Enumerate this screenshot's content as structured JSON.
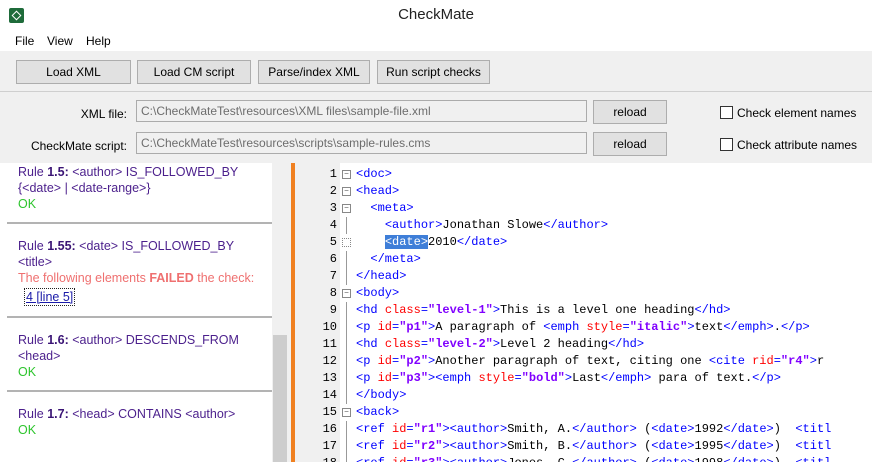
{
  "window": {
    "title": "CheckMate"
  },
  "menu": [
    "File",
    "View",
    "Help"
  ],
  "toolbar": {
    "load_xml": "Load XML",
    "load_cm": "Load CM script",
    "parse": "Parse/index XML",
    "run": "Run script checks"
  },
  "config": {
    "xml_label": "XML file:",
    "xml_value": "C:\\CheckMateTest\\resources\\XML files\\sample-file.xml",
    "script_label": "CheckMate script:",
    "script_value": "C:\\CheckMateTest\\resources\\scripts\\sample-rules.cms",
    "reload": "reload",
    "check_elements": "Check element names",
    "check_attributes": "Check attribute names"
  },
  "rules": [
    {
      "prefix": "Rule ",
      "num": "1.5:",
      "text": " <author> IS_FOLLOWED_BY {<date> | <date-range>}",
      "result": "OK"
    },
    {
      "prefix": "Rule ",
      "num": "1.55:",
      "text": " <date> IS_FOLLOWED_BY <title>",
      "fail_pre": "The following elements ",
      "fail_word": "FAILED",
      "fail_post": " the check:",
      "link": "4 [line 5]"
    },
    {
      "prefix": "Rule ",
      "num": "1.6:",
      "text": " <author> DESCENDS_FROM <head>",
      "result": "OK"
    },
    {
      "prefix": "Rule ",
      "num": "1.7:",
      "text": " <head> CONTAINS <author>",
      "result": "OK"
    }
  ],
  "code_lines": [
    {
      "n": "1",
      "segs": [
        [
          "t",
          "<doc>"
        ]
      ]
    },
    {
      "n": "2",
      "segs": [
        [
          "t",
          "<head>"
        ]
      ]
    },
    {
      "n": "3",
      "segs": [
        [
          "",
          "  "
        ],
        [
          "t",
          "<meta>"
        ]
      ]
    },
    {
      "n": "4",
      "segs": [
        [
          "",
          "    "
        ],
        [
          "t",
          "<author>"
        ],
        [
          "",
          "Jonathan Slowe"
        ],
        [
          "t",
          "</author>"
        ]
      ]
    },
    {
      "n": "5",
      "segs": [
        [
          "",
          "    "
        ],
        [
          "sel",
          "<date>"
        ],
        [
          "",
          "2010"
        ],
        [
          "t",
          "</date>"
        ]
      ]
    },
    {
      "n": "6",
      "segs": [
        [
          "",
          "  "
        ],
        [
          "t",
          "</meta>"
        ]
      ]
    },
    {
      "n": "7",
      "segs": [
        [
          "t",
          "</head>"
        ]
      ]
    },
    {
      "n": "8",
      "segs": [
        [
          "t",
          "<body>"
        ]
      ]
    },
    {
      "n": "9",
      "segs": [
        [
          "t",
          "<hd "
        ],
        [
          "a",
          "class"
        ],
        [
          "t",
          "="
        ],
        [
          "v",
          "\"level-1\""
        ],
        [
          "t",
          ">"
        ],
        [
          "",
          "This is a level one heading"
        ],
        [
          "t",
          "</hd>"
        ]
      ]
    },
    {
      "n": "10",
      "segs": [
        [
          "t",
          "<p "
        ],
        [
          "a",
          "id"
        ],
        [
          "t",
          "="
        ],
        [
          "v",
          "\"p1\""
        ],
        [
          "t",
          ">"
        ],
        [
          "",
          "A paragraph of "
        ],
        [
          "t",
          "<emph "
        ],
        [
          "a",
          "style"
        ],
        [
          "t",
          "="
        ],
        [
          "v",
          "\"italic\""
        ],
        [
          "t",
          ">"
        ],
        [
          "",
          "text"
        ],
        [
          "t",
          "</emph>"
        ],
        [
          "",
          "."
        ],
        [
          "t",
          "</p>"
        ]
      ]
    },
    {
      "n": "11",
      "segs": [
        [
          "t",
          "<hd "
        ],
        [
          "a",
          "class"
        ],
        [
          "t",
          "="
        ],
        [
          "v",
          "\"level-2\""
        ],
        [
          "t",
          ">"
        ],
        [
          "",
          "Level 2 heading"
        ],
        [
          "t",
          "</hd>"
        ]
      ]
    },
    {
      "n": "12",
      "segs": [
        [
          "t",
          "<p "
        ],
        [
          "a",
          "id"
        ],
        [
          "t",
          "="
        ],
        [
          "v",
          "\"p2\""
        ],
        [
          "t",
          ">"
        ],
        [
          "",
          "Another paragraph of text, citing one "
        ],
        [
          "t",
          "<cite "
        ],
        [
          "a",
          "rid"
        ],
        [
          "t",
          "="
        ],
        [
          "v",
          "\"r4\""
        ],
        [
          "t",
          ">"
        ],
        [
          "",
          "r"
        ]
      ]
    },
    {
      "n": "13",
      "segs": [
        [
          "t",
          "<p "
        ],
        [
          "a",
          "id"
        ],
        [
          "t",
          "="
        ],
        [
          "v",
          "\"p3\""
        ],
        [
          "t",
          ">"
        ],
        [
          "t",
          "<emph "
        ],
        [
          "a",
          "style"
        ],
        [
          "t",
          "="
        ],
        [
          "v",
          "\"bold\""
        ],
        [
          "t",
          ">"
        ],
        [
          "",
          "Last"
        ],
        [
          "t",
          "</emph>"
        ],
        [
          "",
          " para of text."
        ],
        [
          "t",
          "</p>"
        ]
      ]
    },
    {
      "n": "14",
      "segs": [
        [
          "t",
          "</body>"
        ]
      ]
    },
    {
      "n": "15",
      "segs": [
        [
          "t",
          "<back>"
        ]
      ]
    },
    {
      "n": "16",
      "segs": [
        [
          "t",
          "<ref "
        ],
        [
          "a",
          "id"
        ],
        [
          "t",
          "="
        ],
        [
          "v",
          "\"r1\""
        ],
        [
          "t",
          ">"
        ],
        [
          "t",
          "<author>"
        ],
        [
          "",
          "Smith, A."
        ],
        [
          "t",
          "</author>"
        ],
        [
          "",
          " ("
        ],
        [
          "t",
          "<date>"
        ],
        [
          "",
          "1992"
        ],
        [
          "t",
          "</date>"
        ],
        [
          "",
          ")  "
        ],
        [
          "t",
          "<titl"
        ]
      ]
    },
    {
      "n": "17",
      "segs": [
        [
          "t",
          "<ref "
        ],
        [
          "a",
          "id"
        ],
        [
          "t",
          "="
        ],
        [
          "v",
          "\"r2\""
        ],
        [
          "t",
          ">"
        ],
        [
          "t",
          "<author>"
        ],
        [
          "",
          "Smith, B."
        ],
        [
          "t",
          "</author>"
        ],
        [
          "",
          " ("
        ],
        [
          "t",
          "<date>"
        ],
        [
          "",
          "1995"
        ],
        [
          "t",
          "</date>"
        ],
        [
          "",
          ")  "
        ],
        [
          "t",
          "<titl"
        ]
      ]
    },
    {
      "n": "18",
      "segs": [
        [
          "t",
          "<ref "
        ],
        [
          "a",
          "id"
        ],
        [
          "t",
          "="
        ],
        [
          "v",
          "\"r3\""
        ],
        [
          "t",
          ">"
        ],
        [
          "t",
          "<author>"
        ],
        [
          "",
          "Jones, C."
        ],
        [
          "t",
          "</author>"
        ],
        [
          "",
          " ("
        ],
        [
          "t",
          "<date>"
        ],
        [
          "",
          "1998"
        ],
        [
          "t",
          "</date>"
        ],
        [
          "",
          ")  "
        ],
        [
          "t",
          "<titl"
        ]
      ]
    }
  ],
  "fold_markers": {
    "1": "box",
    "2": "box",
    "3": "box",
    "5": "dot",
    "8": "box",
    "15": "box"
  }
}
